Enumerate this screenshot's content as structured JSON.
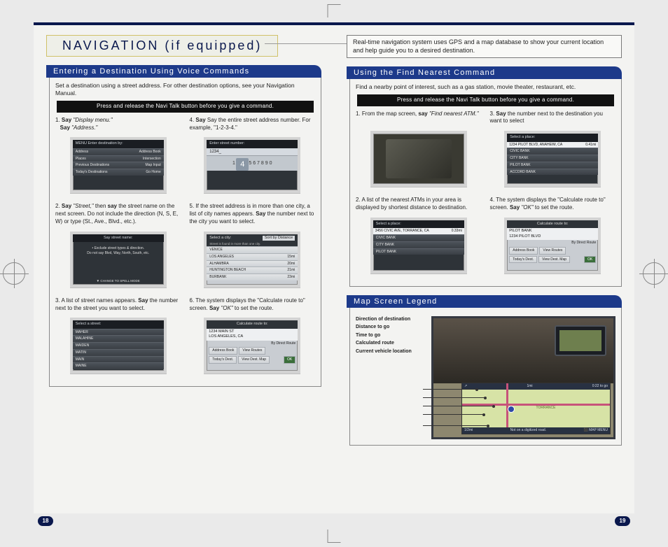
{
  "title": "NAVIGATION (if equipped)",
  "intro": "Real-time navigation system uses GPS and a map database to show your current location and help guide you to a desired destination.",
  "section1": {
    "heading": "Entering a Destination Using Voice Commands",
    "desc": "Set a destination using a street address. For other destination options, see your Navigation Manual.",
    "bar": "Press and release the Navi Talk button before you give a command.",
    "s1a": "Say ",
    "s1b": "\"Display menu.\"",
    "s1c": "Say ",
    "s1d": "\"Address.\"",
    "s2": "Say \"Street,\" then say the street name on the next screen. Do not include the direction (N, S, E, W) or type (St., Ave., Blvd., etc.).",
    "s3": "A list of street names appears. Say the number next to the street you want to select.",
    "s4": "Say the entire street address number. For example, \"1-2-3-4.\"",
    "s5": "If the street address is in more than one city, a list of city names appears. Say the number next to the city you want to select.",
    "s6": "The system displays the \"Calculate route to\" screen. Say \"OK\" to set the route.",
    "shot1": {
      "menu_hdr": "MENU    Enter destination by:",
      "r1a": "Address",
      "r1b": "Address Book",
      "r2a": "Places",
      "r2b": "Intersection",
      "r3a": "Previous Destinations",
      "r3b": "Map Input",
      "r4a": "Today's Destinations",
      "r4b": "Go Home"
    },
    "shot2": {
      "hdr": "Say street name:",
      "line1": "• Exclude street types & direction.",
      "line2": "Do not say Blvd, Way, North, South, etc.",
      "foot": "▼ CHANGE TO SPELL MODE"
    },
    "shot3": {
      "hdr": "Select a street:",
      "rows": [
        "MAHER",
        "MALAHINE",
        "MAIDEN",
        "MATIN",
        "MAIN",
        "MAINE"
      ]
    },
    "shot4": {
      "hdr": "Enter street number:",
      "box": "1234_",
      "line": "1 2 3 4 5 6 7 8 9 0"
    },
    "shot5": {
      "hdr": "Select a city:",
      "sub": "Street is found in more than one city.",
      "sort": "Sort by Distance",
      "rows": [
        {
          "n": "VENICE",
          "d": ""
        },
        {
          "n": "LOS ANGELES",
          "d": "15mi"
        },
        {
          "n": "ALHAMBRA",
          "d": "20mi"
        },
        {
          "n": "HUNTINGTON BEACH",
          "d": "21mi"
        },
        {
          "n": "BURBANK",
          "d": "23mi"
        }
      ]
    },
    "shot6": {
      "hdr": "Calculate route to:",
      "addr1": "1234 MAIN ST",
      "addr2": "LOS ANGELES, CA",
      "b1": "Address Book",
      "b2": "View Routes",
      "b3": "Today's Dest.",
      "b4": "View Dest. Map",
      "route": "By Direct Route",
      "ok": "OK"
    }
  },
  "section2": {
    "heading": "Using the Find Nearest Command",
    "desc": "Find a nearby point of interest, such as a gas station, movie theater, restaurant, etc.",
    "bar": "Press and release the Navi Talk button before you give a command.",
    "s1": "From the map screen, say \"Find nearest ATM.\"",
    "s2": "A list of the nearest ATMs in your area is displayed by shortest distance to destination.",
    "s3": "Say the number next to the destination you want to select",
    "s4": "The system displays the \"Calculate route to\" screen. Say \"OK\" to set the route.",
    "shotA": {
      "hdr": "Select a place:",
      "addr": "3456 CIVIC AVE, TORRANCE, CA",
      "dist": "0.33mi",
      "rows": [
        "CIVIC BANK",
        "CITY BANK",
        "PILOT BANK"
      ]
    },
    "shotB": {
      "hdr": "Select a place:",
      "addr": "1234 PILOT BLVD, ANAHEIM, CA",
      "dist": "0.41mi",
      "rows": [
        "CIVIC BANK",
        "CITY BANK",
        "PILOT BANK",
        "ACCORD BANK"
      ]
    },
    "shotC": {
      "hdr": "Calculate route to:",
      "addr1": "PILOT BANK",
      "addr2": "1234 PILOT BLVD",
      "b1": "Address Book",
      "b2": "View Routes",
      "b3": "Today's Dest.",
      "b4": "View Dest. Map",
      "route": "By Direct Route",
      "ok": "OK"
    }
  },
  "section3": {
    "heading": "Map Screen Legend",
    "labels": [
      "Direction of destination",
      "Distance to go",
      "Time to go",
      "Calculated route",
      "Current vehicle location"
    ],
    "maptop_dist": "1mi",
    "maptop_time": "0:22 to go",
    "city": "TORRANCE",
    "mapbar_left": "1/2mi",
    "mapbar_mid": "Not on a digitized road.",
    "mapbar_right": "⬛ MAP MENU"
  },
  "pages": {
    "left": "18",
    "right": "19"
  }
}
